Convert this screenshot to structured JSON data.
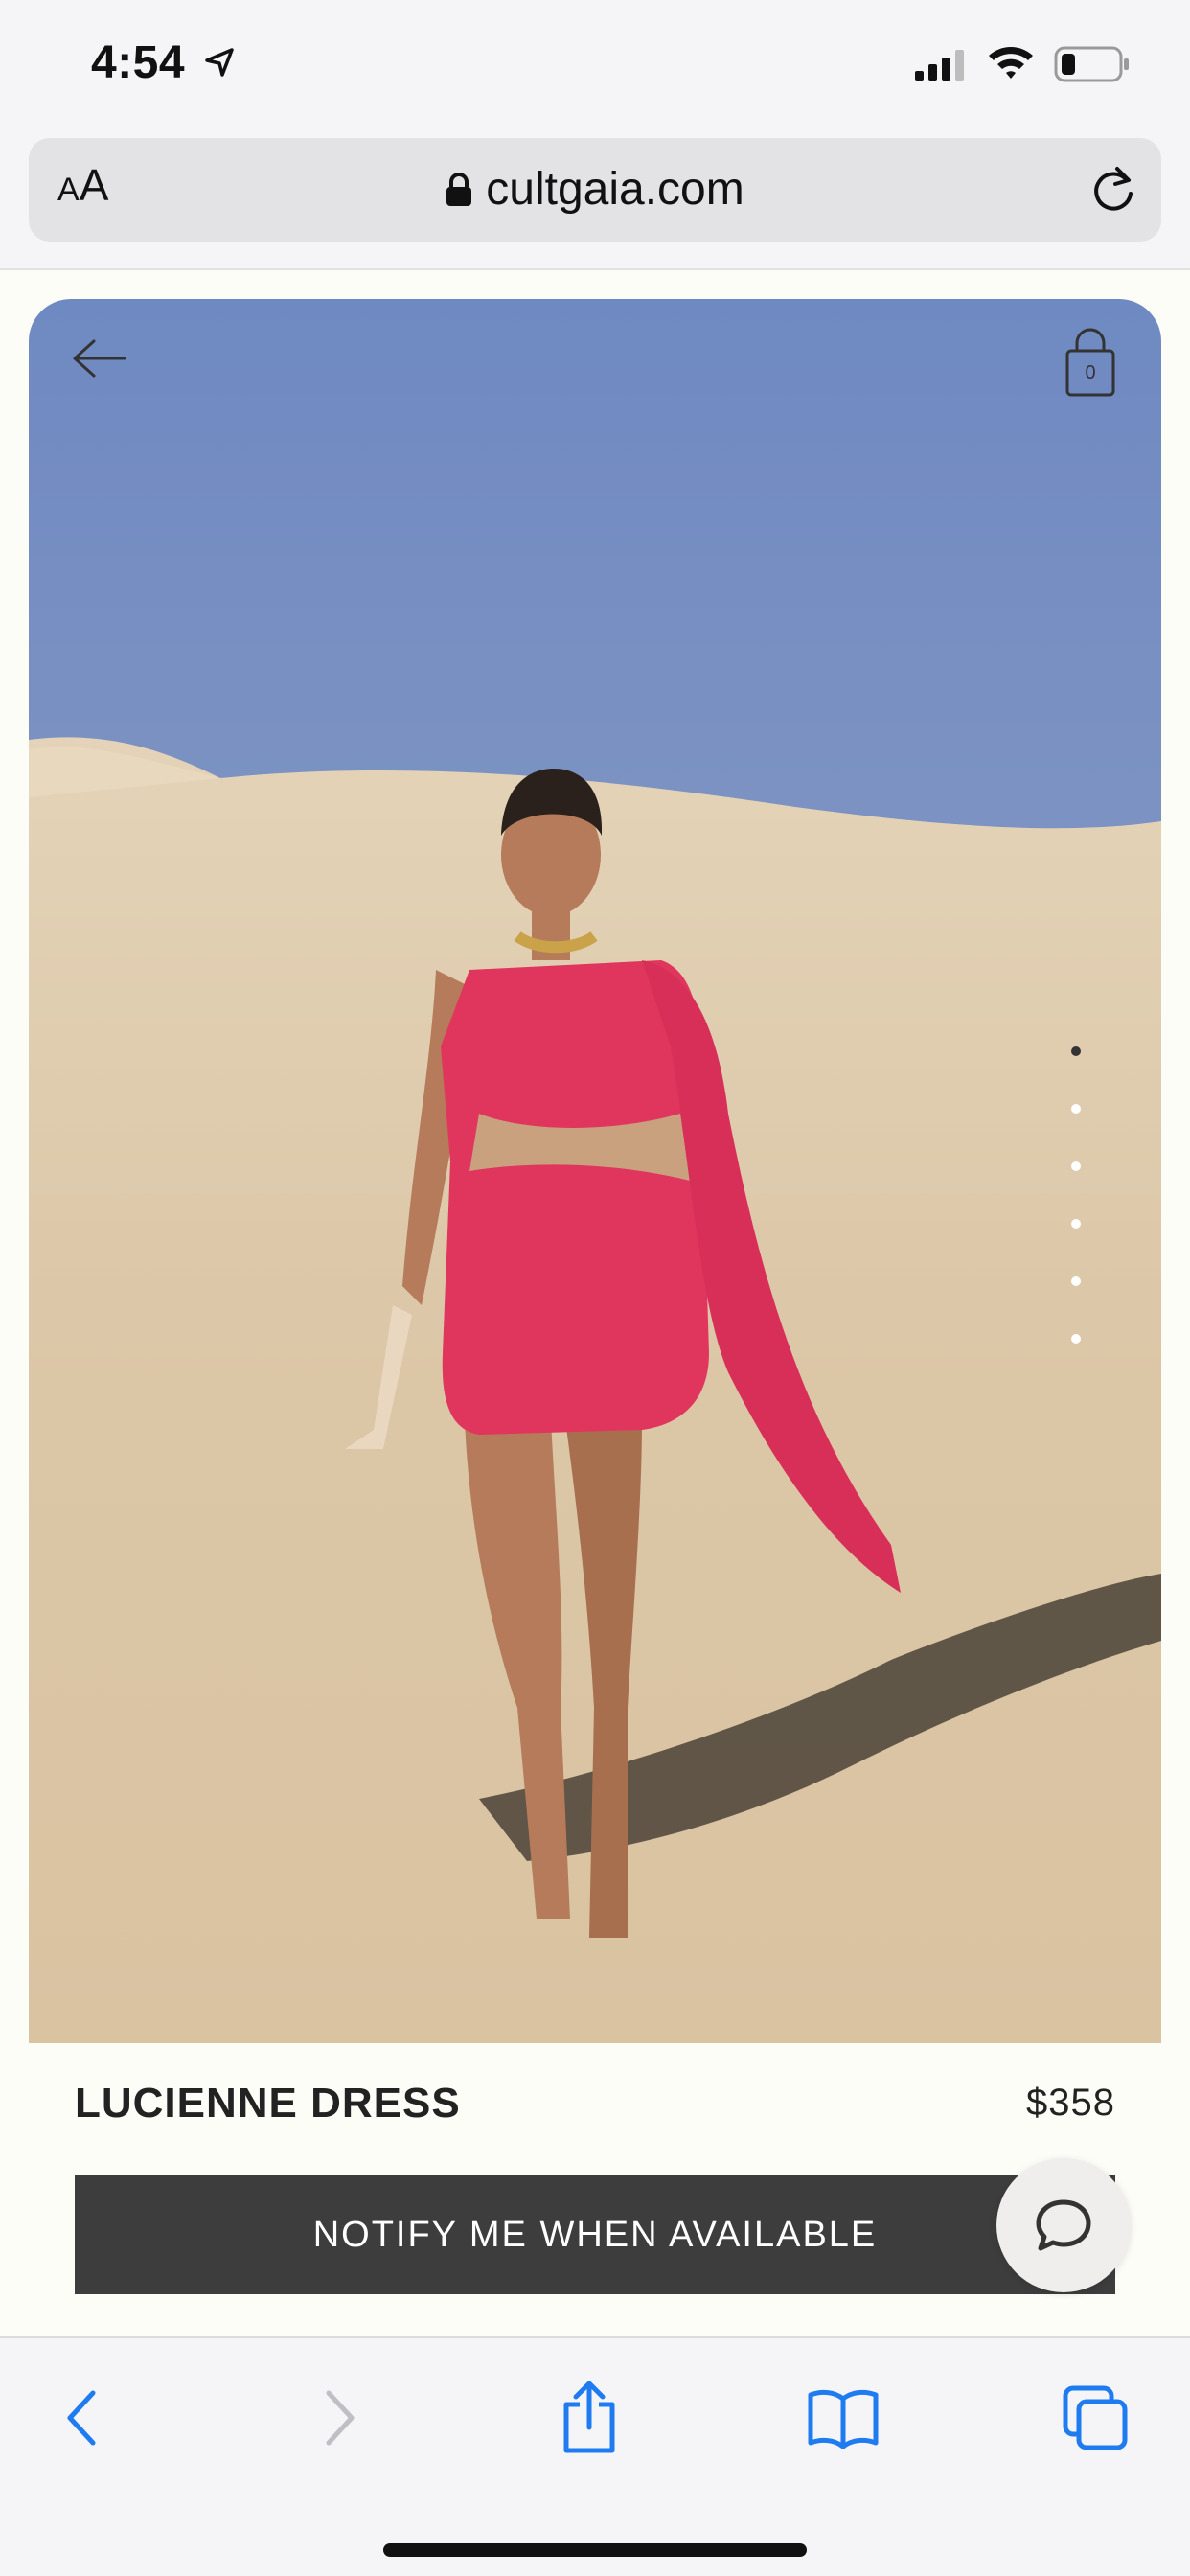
{
  "status": {
    "time": "4:54"
  },
  "browser": {
    "text_size_large": "A",
    "text_size_small": "A",
    "url": "cultgaia.com"
  },
  "product": {
    "name": "LUCIENNE DRESS",
    "price": "$358",
    "cart_count": "0",
    "image_count": 6,
    "active_image": 1,
    "notify_label": "NOTIFY ME WHEN AVAILABLE"
  },
  "colors": {
    "dress": "#e0365d",
    "button": "#3d3d3d",
    "browser_accent": "#1f7cf0"
  },
  "icons": {
    "back": "arrow-left-icon",
    "bag": "shopping-bag-icon",
    "chat": "chat-bubble-icon",
    "toolbar": [
      "chevron-left-icon",
      "chevron-right-icon",
      "share-icon",
      "bookmarks-icon",
      "tabs-icon"
    ]
  }
}
